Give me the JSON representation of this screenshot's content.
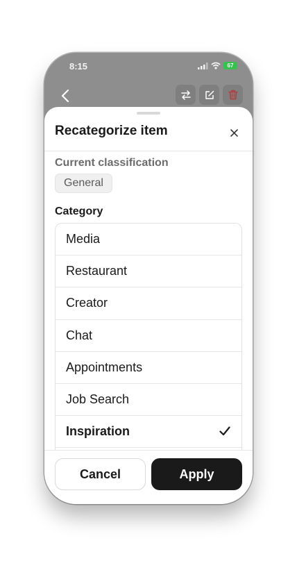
{
  "status_bar": {
    "time": "8:15",
    "battery": "67"
  },
  "sheet": {
    "title": "Recategorize item",
    "current_label": "Current classification",
    "current_value": "General",
    "category_label": "Category",
    "categories": [
      {
        "label": "Media",
        "selected": false
      },
      {
        "label": "Restaurant",
        "selected": false
      },
      {
        "label": "Creator",
        "selected": false
      },
      {
        "label": "Chat",
        "selected": false
      },
      {
        "label": "Appointments",
        "selected": false
      },
      {
        "label": "Job Search",
        "selected": false
      },
      {
        "label": "Inspiration",
        "selected": true
      }
    ]
  },
  "footer": {
    "cancel_label": "Cancel",
    "apply_label": "Apply"
  },
  "colors": {
    "accent": "#1a1a1a",
    "delete": "#b53a3a",
    "battery": "#36c24f"
  },
  "icons": [
    "chevron-left-icon",
    "swap-icon",
    "edit-icon",
    "trash-icon",
    "close-icon",
    "checkmark-icon"
  ]
}
